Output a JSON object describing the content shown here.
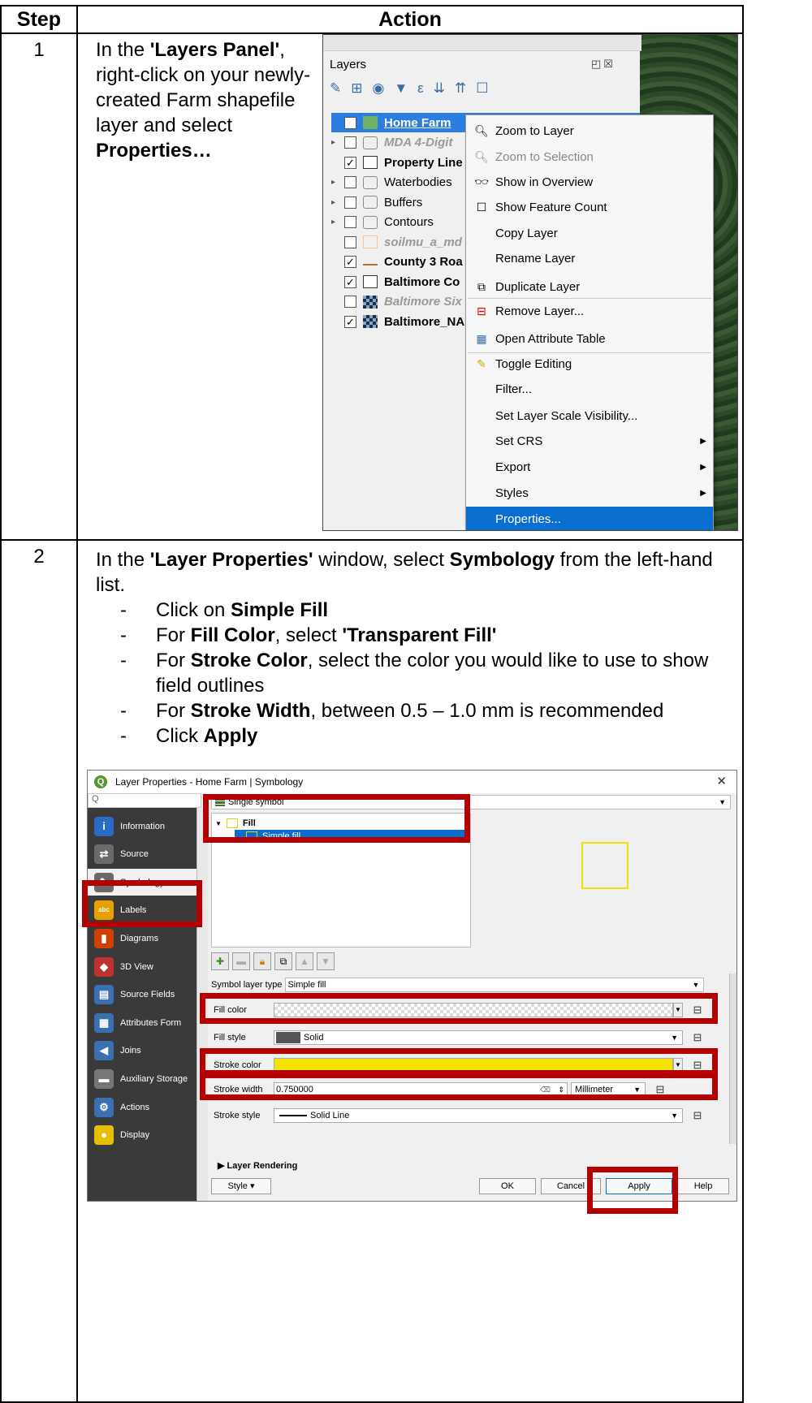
{
  "table": {
    "header_step": "Step",
    "header_action": "Action",
    "rows": [
      {
        "num": "1",
        "text_parts": [
          "In the ",
          "'Layers Panel'",
          ", right-click on your newly-created Farm shapefile layer and select ",
          "Properties…"
        ]
      },
      {
        "num": "2",
        "intro_parts": [
          "In the ",
          "'Layer Properties'",
          " window, select ",
          "Symbology",
          " from the left-hand list."
        ],
        "bullets": [
          {
            "pre": "Click on ",
            "bold": "Simple Fill",
            "post": ""
          },
          {
            "pre": "For ",
            "bold": "Fill Color",
            "mid": ", select ",
            "bold2": "'Transparent Fill'",
            "post": ""
          },
          {
            "pre": "For ",
            "bold": "Stroke Color",
            "post": ",  select the color you would like to use to show field outlines"
          },
          {
            "pre": "For ",
            "bold": "Stroke Width",
            "post": ", between 0.5 – 1.0 mm is recommended"
          },
          {
            "pre": "Click ",
            "bold": "Apply",
            "post": ""
          }
        ]
      }
    ]
  },
  "layers_panel": {
    "title": "Layers",
    "title_buttons": "◰☒",
    "layers": [
      {
        "name": "Home Farm",
        "checked": "✓",
        "style": "selected"
      },
      {
        "name": "MDA 4-Digit",
        "checked": "",
        "style": "italic"
      },
      {
        "name": "Property Line",
        "checked": "✓",
        "style": "bold"
      },
      {
        "name": "Waterbodies",
        "checked": "",
        "style": "normal"
      },
      {
        "name": "Buffers",
        "checked": "",
        "style": "normal"
      },
      {
        "name": "Contours",
        "checked": "",
        "style": "normal"
      },
      {
        "name": "soilmu_a_md",
        "checked": "",
        "style": "italic"
      },
      {
        "name": "County 3 Roa",
        "checked": "✓",
        "style": "bold"
      },
      {
        "name": "Baltimore Co",
        "checked": "✓",
        "style": "bold"
      },
      {
        "name": "Baltimore Six",
        "checked": "",
        "style": "italic"
      },
      {
        "name": "Baltimore_NA",
        "checked": "✓",
        "style": "bold"
      }
    ]
  },
  "context_menu": {
    "items": [
      {
        "label": "Zoom to Layer",
        "icon": "zoom-icon"
      },
      {
        "label": "Zoom to Selection",
        "icon": "zoom-selection-icon",
        "disabled": true
      },
      {
        "label": "Show in Overview",
        "icon": "overview-icon"
      },
      {
        "label": "Show Feature Count",
        "icon": "checkbox-icon"
      },
      {
        "label": "Copy Layer"
      },
      {
        "label": "Rename Layer"
      },
      {
        "label": "Duplicate Layer",
        "icon": "duplicate-icon"
      },
      {
        "label": "Remove Layer...",
        "icon": "remove-icon"
      },
      {
        "label": "Open Attribute Table",
        "icon": "table-icon"
      },
      {
        "label": "Toggle Editing",
        "icon": "pencil-icon"
      },
      {
        "label": "Filter..."
      },
      {
        "label": "Set Layer Scale Visibility..."
      },
      {
        "label": "Set CRS",
        "submenu": true
      },
      {
        "label": "Export",
        "submenu": true
      },
      {
        "label": "Styles",
        "submenu": true
      },
      {
        "label": "Properties...",
        "selected": true
      }
    ]
  },
  "properties_dialog": {
    "title": "Layer Properties - Home Farm | Symbology",
    "search_placeholder": "Q",
    "sidebar": [
      "Information",
      "Source",
      "Symbology",
      "Labels",
      "Diagrams",
      "3D View",
      "Source Fields",
      "Attributes Form",
      "Joins",
      "Auxiliary Storage",
      "Actions",
      "Display"
    ],
    "renderer": "Single symbol",
    "tree": {
      "fill": "Fill",
      "simple_fill": "Simple fill"
    },
    "symbol_layer_type_label": "Symbol layer type",
    "symbol_layer_type": "Simple fill",
    "fill_color_label": "Fill color",
    "fill_style_label": "Fill style",
    "fill_style": "Solid",
    "stroke_color_label": "Stroke color",
    "stroke_color": "#f5e400",
    "stroke_width_label": "Stroke width",
    "stroke_width": "0.750000",
    "stroke_unit": "Millimeter",
    "stroke_style_label": "Stroke style",
    "stroke_style": "Solid Line",
    "layer_rendering": "Layer Rendering",
    "style_btn": "Style",
    "ok": "OK",
    "cancel": "Cancel",
    "apply": "Apply",
    "help": "Help"
  },
  "colors": {
    "highlight": "#b40000",
    "selection": "#0a6ed1",
    "sidebar": "#3a3a3a"
  }
}
